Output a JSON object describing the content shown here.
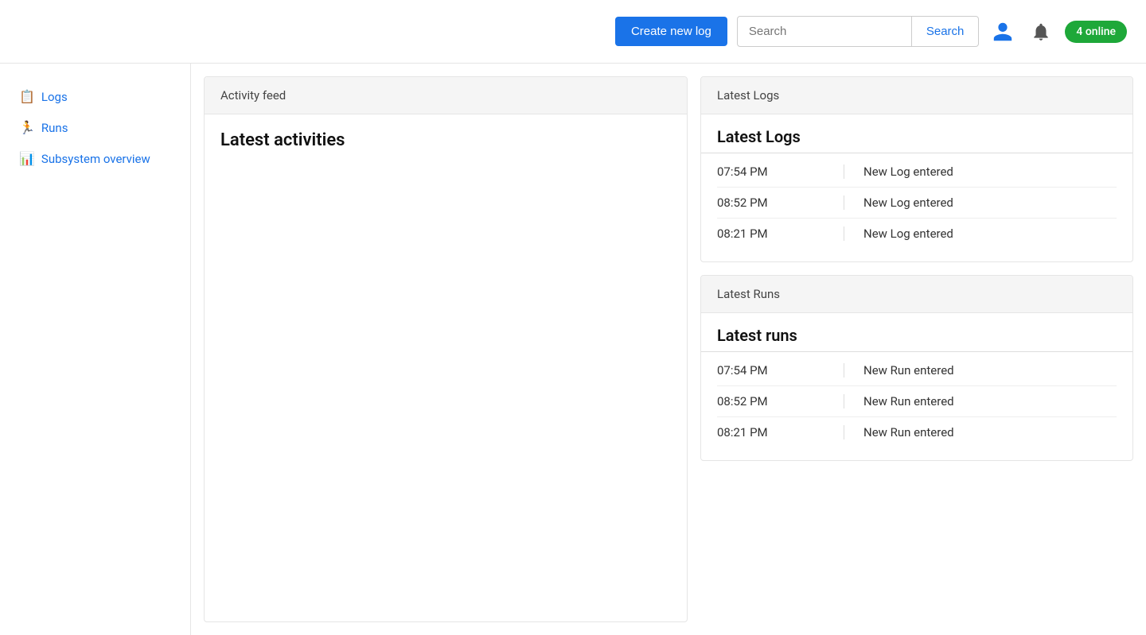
{
  "topbar": {
    "create_btn_label": "Create new log",
    "search_placeholder": "Search",
    "search_btn_label": "Search",
    "online_badge": "4 online"
  },
  "sidebar": {
    "items": [
      {
        "id": "logs",
        "label": "Logs",
        "icon": "📋"
      },
      {
        "id": "runs",
        "label": "Runs",
        "icon": "🏃"
      },
      {
        "id": "subsystem",
        "label": "Subsystem overview",
        "icon": "📊"
      }
    ]
  },
  "activity_feed": {
    "header": "Activity feed",
    "title": "Latest activities"
  },
  "latest_logs": {
    "panel_header": "Latest Logs",
    "section_title": "Latest Logs",
    "entries": [
      {
        "time": "07:54 PM",
        "message": "New Log entered"
      },
      {
        "time": "08:52 PM",
        "message": "New Log entered"
      },
      {
        "time": "08:21 PM",
        "message": "New Log entered"
      }
    ]
  },
  "latest_runs": {
    "panel_header": "Latest Runs",
    "section_title": "Latest runs",
    "entries": [
      {
        "time": "07:54 PM",
        "message": "New Run entered"
      },
      {
        "time": "08:52 PM",
        "message": "New Run entered"
      },
      {
        "time": "08:21 PM",
        "message": "New Run entered"
      }
    ]
  }
}
